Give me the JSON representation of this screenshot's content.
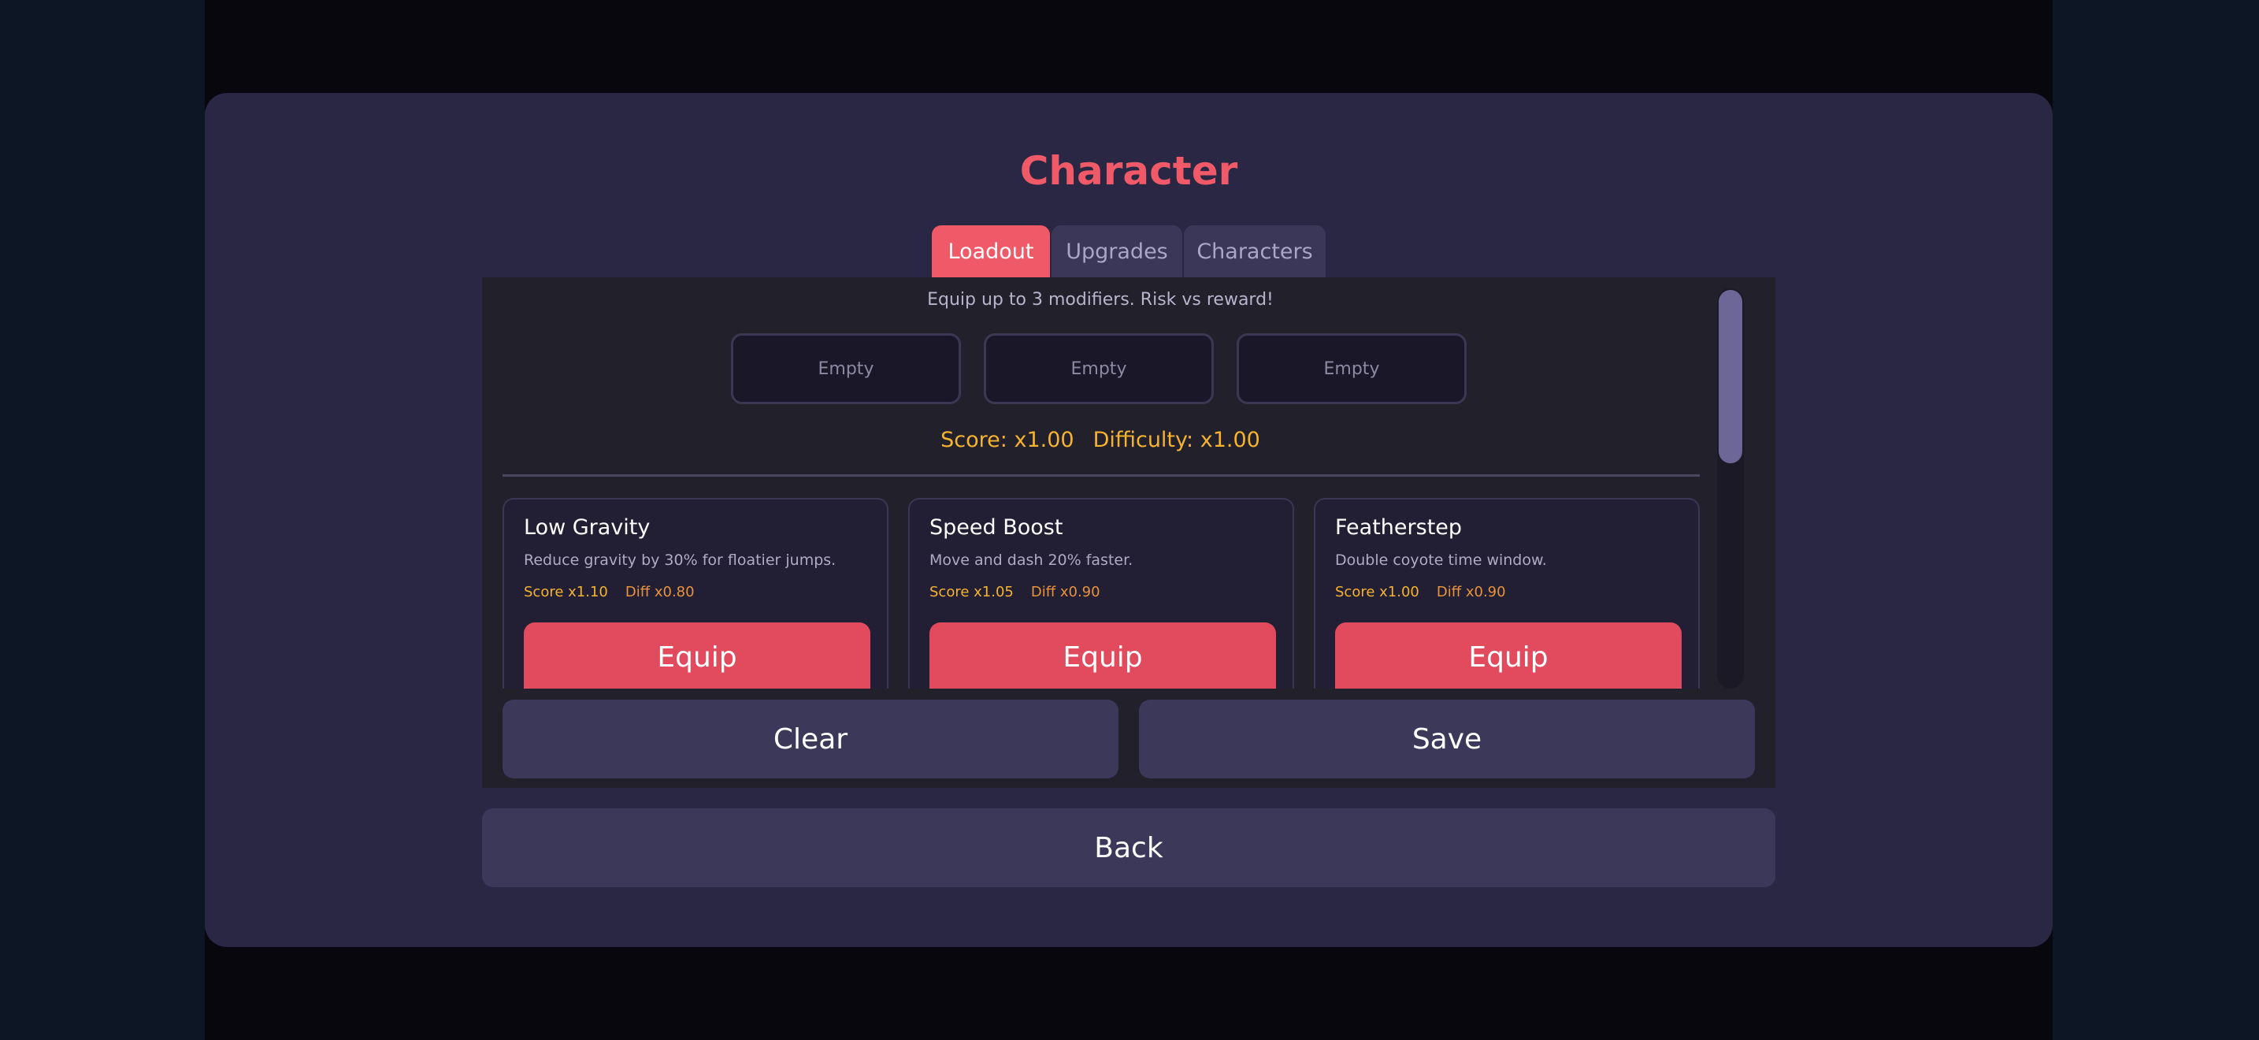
{
  "menu": {
    "title": "Character",
    "tabs": [
      {
        "label": "Loadout",
        "active": true
      },
      {
        "label": "Upgrades",
        "active": false
      },
      {
        "label": "Characters",
        "active": false
      }
    ]
  },
  "loadout": {
    "intro": "Equip up to 3 modifiers. Risk vs reward!",
    "slots": [
      "Empty",
      "Empty",
      "Empty"
    ],
    "score": "Score: x1.00",
    "difficulty": "Difficulty: x1.00",
    "modifiers": [
      {
        "name": "Low Gravity",
        "description": "Reduce gravity by 30% for floatier jumps.",
        "score": "Score x1.10",
        "diff": "Diff x0.80",
        "button": "Equip"
      },
      {
        "name": "Speed Boost",
        "description": "Move and dash 20% faster.",
        "score": "Score x1.05",
        "diff": "Diff x0.90",
        "button": "Equip"
      },
      {
        "name": "Featherstep",
        "description": "Double coyote time window.",
        "score": "Score x1.00",
        "diff": "Diff x0.90",
        "button": "Equip"
      }
    ],
    "clear_label": "Clear",
    "save_label": "Save"
  },
  "back_label": "Back",
  "colors": {
    "accent": "#f05a68",
    "equip_button": "#e24b5e",
    "score_text": "#f5b32f",
    "panel": "#2a2744",
    "button": "#3b3859"
  }
}
